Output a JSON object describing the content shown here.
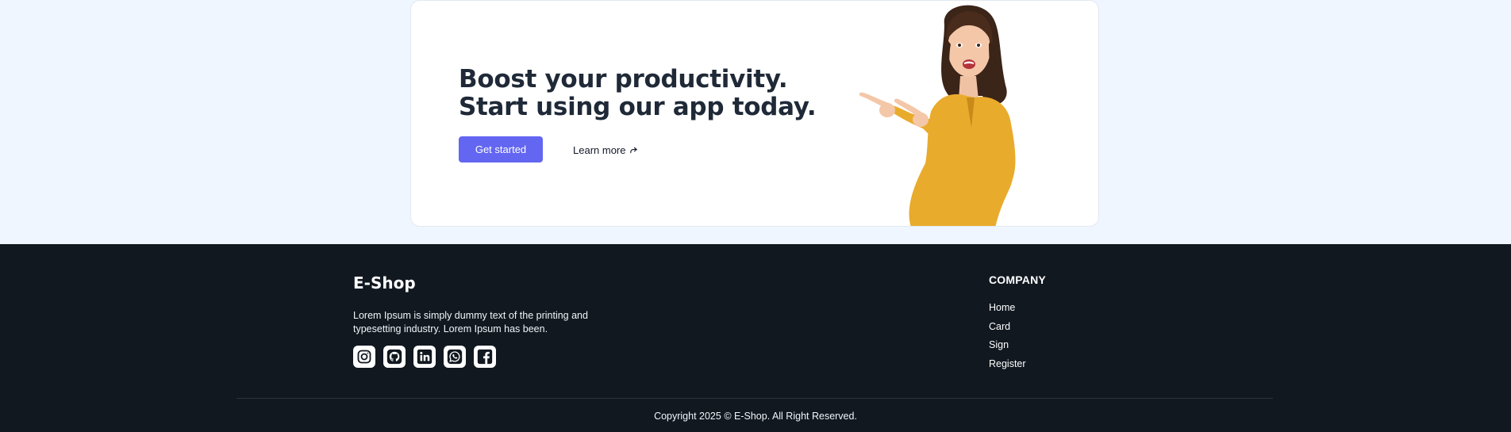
{
  "cta": {
    "heading_line1": "Boost your productivity.",
    "heading_line2": "Start using our app today.",
    "primary_label": "Get started",
    "secondary_label": "Learn more",
    "secondary_icon": "share-arrow-icon",
    "accent_color": "#6366f1"
  },
  "footer": {
    "brand": "E-Shop",
    "about": "Lorem Ipsum is simply dummy text of the printing and typesetting industry. Lorem Ipsum has been.",
    "socials": [
      {
        "icon": "instagram-icon"
      },
      {
        "icon": "github-icon"
      },
      {
        "icon": "linkedin-icon"
      },
      {
        "icon": "whatsapp-icon"
      },
      {
        "icon": "facebook-icon"
      }
    ],
    "company_title": "COMPANY",
    "company_links": [
      "Home",
      "Card",
      "Sign",
      "Register"
    ],
    "copyright": "Copyright 2025 © E-Shop. All Right Reserved.",
    "background_color": "#111820"
  }
}
